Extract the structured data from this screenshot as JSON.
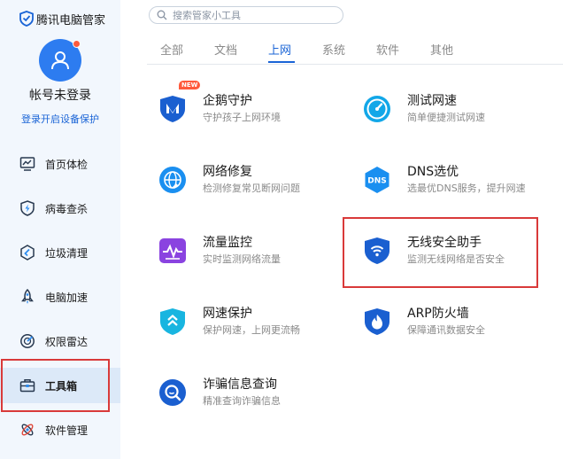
{
  "app": {
    "title": "腾讯电脑管家"
  },
  "account": {
    "status": "帐号未登录",
    "login_link": "登录开启设备保护"
  },
  "search": {
    "placeholder": "搜索管家小工具"
  },
  "tabs": [
    {
      "label": "全部",
      "active": false
    },
    {
      "label": "文档",
      "active": false
    },
    {
      "label": "上网",
      "active": true
    },
    {
      "label": "系统",
      "active": false
    },
    {
      "label": "软件",
      "active": false
    },
    {
      "label": "其他",
      "active": false
    }
  ],
  "sidebar": {
    "items": [
      {
        "label": "首页体检",
        "icon": "monitor-icon",
        "active": false
      },
      {
        "label": "病毒查杀",
        "icon": "shield-bolt-icon",
        "active": false
      },
      {
        "label": "垃圾清理",
        "icon": "clean-icon",
        "active": false
      },
      {
        "label": "电脑加速",
        "icon": "rocket-icon",
        "active": false
      },
      {
        "label": "权限雷达",
        "icon": "radar-icon",
        "active": false
      },
      {
        "label": "工具箱",
        "icon": "toolbox-icon",
        "active": true
      },
      {
        "label": "软件管理",
        "icon": "software-icon",
        "active": false
      }
    ]
  },
  "tools": [
    {
      "name": "企鹅守护",
      "desc": "守护孩子上网环境",
      "badge": "NEW",
      "icon": "penguin-guard-icon"
    },
    {
      "name": "测试网速",
      "desc": "简单便捷测试网速",
      "icon": "speedometer-icon"
    },
    {
      "name": "网络修复",
      "desc": "检测修复常见断网问题",
      "icon": "network-repair-icon"
    },
    {
      "name": "DNS选优",
      "desc": "选最优DNS服务，提升网速",
      "icon": "dns-icon",
      "icon_text": "DNS"
    },
    {
      "name": "流量监控",
      "desc": "实时监测网络流量",
      "icon": "traffic-monitor-icon"
    },
    {
      "name": "无线安全助手",
      "desc": "监测无线网络是否安全",
      "icon": "wifi-shield-icon"
    },
    {
      "name": "网速保护",
      "desc": "保护网速，上网更流畅",
      "icon": "speed-protect-icon"
    },
    {
      "name": "ARP防火墙",
      "desc": "保障通讯数据安全",
      "icon": "arp-firewall-icon"
    },
    {
      "name": "诈骗信息查询",
      "desc": "精准查询诈骗信息",
      "icon": "fraud-search-icon"
    }
  ],
  "colors": {
    "accent": "#1a64d6",
    "highlight_box": "#d93a3a",
    "sidebar_bg": "#f2f7fd"
  }
}
